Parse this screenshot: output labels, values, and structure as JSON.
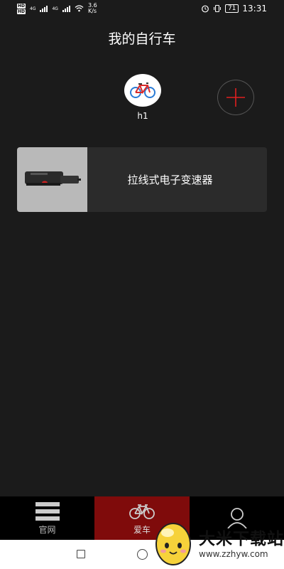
{
  "status_bar": {
    "hd1": "HD",
    "hd2": "HD",
    "net1": "4G",
    "net2": "4G",
    "speed_value": "3.6",
    "speed_unit": "K/s",
    "battery": "71",
    "time": "13:31"
  },
  "header": {
    "title": "我的自行车"
  },
  "bikes": [
    {
      "name": "h1",
      "icon": "bicycle-icon"
    }
  ],
  "add_button": {
    "icon": "plus-icon",
    "color": "#e02020"
  },
  "products": [
    {
      "label": "拉线式电子变速器",
      "icon": "derailleur-image"
    }
  ],
  "tabs": [
    {
      "label": "官网",
      "icon": "menu-icon",
      "active": false
    },
    {
      "label": "爱车",
      "icon": "bicycle-icon",
      "active": true
    },
    {
      "label": "",
      "icon": "user-icon",
      "active": false
    }
  ],
  "system_nav": {
    "recent": "square-icon",
    "home": "circle-icon"
  },
  "watermark": {
    "title": "大米下载站",
    "url": "www.zzhyw.com"
  },
  "colors": {
    "background": "#1b1b1b",
    "card": "#2b2b2b",
    "active_tab": "#7f0b0b",
    "accent": "#e02020"
  }
}
